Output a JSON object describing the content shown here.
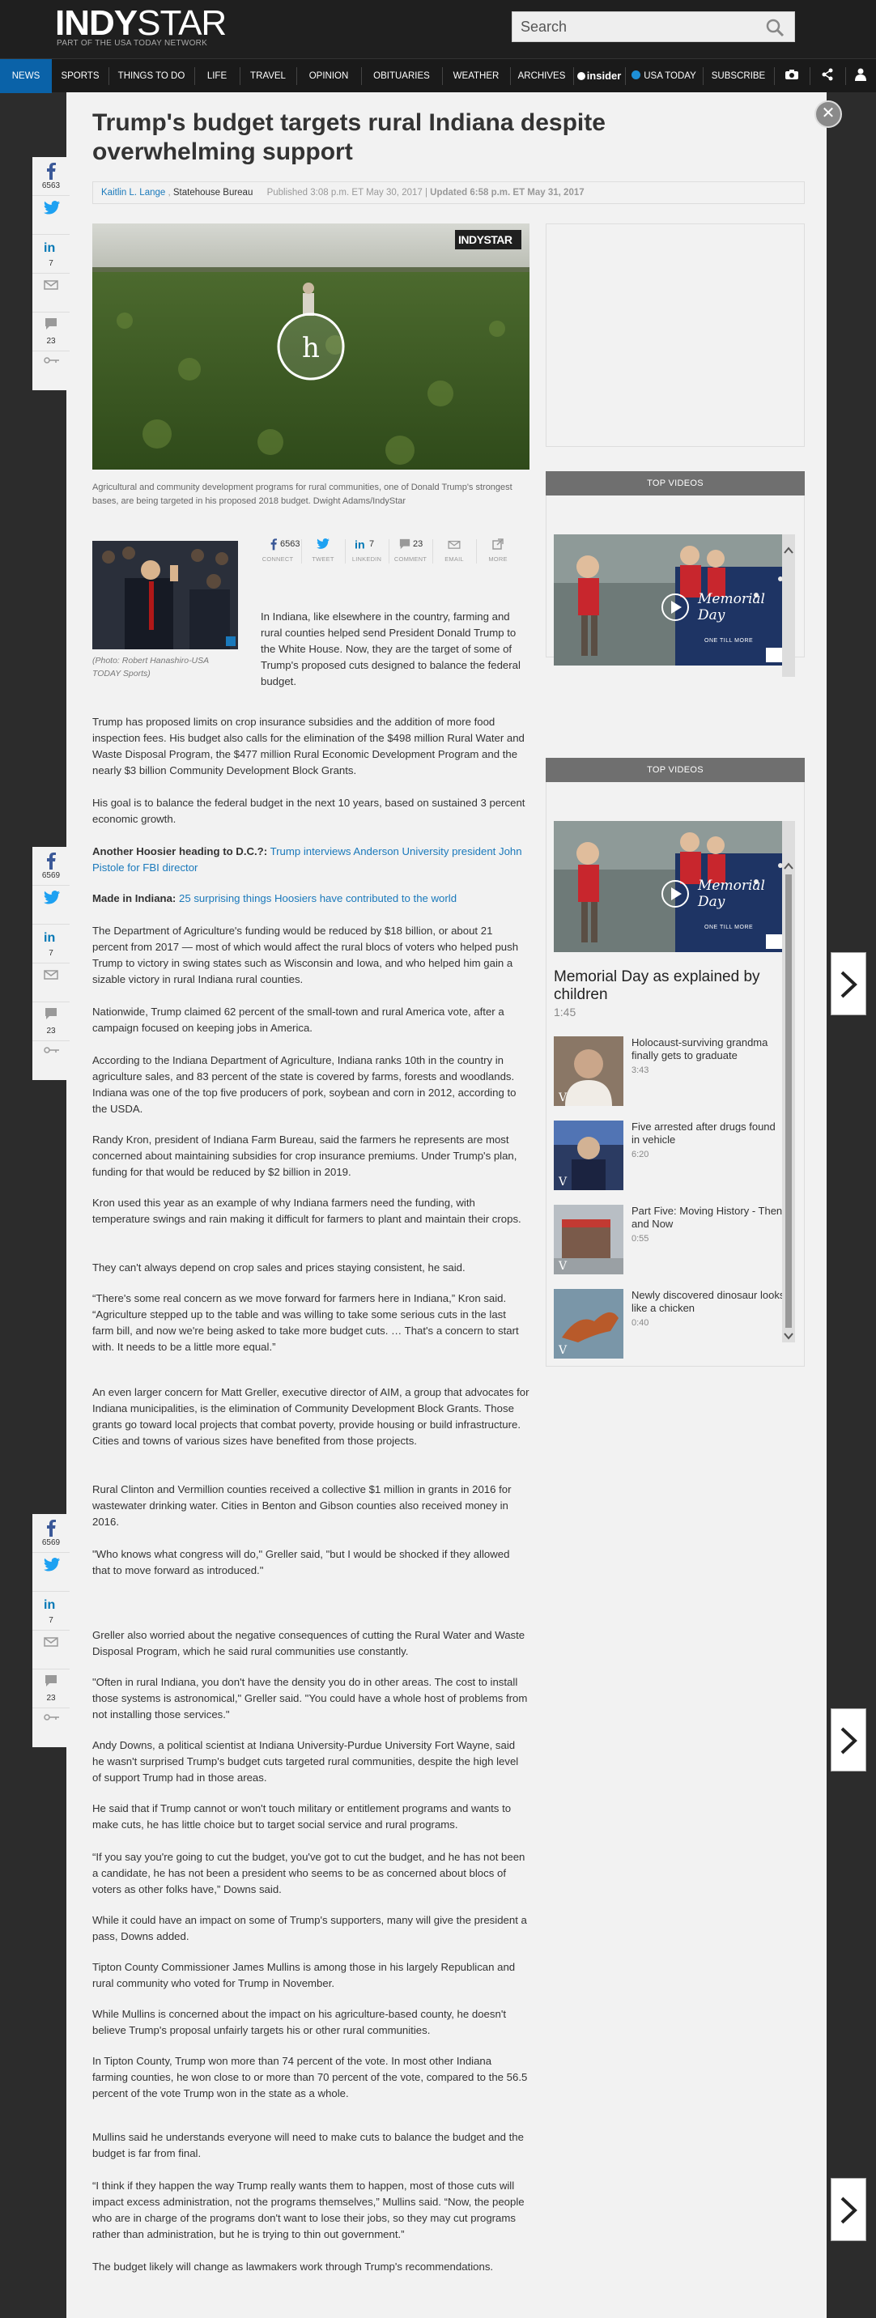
{
  "brand": {
    "name_bold": "INDY",
    "name_thin": "STAR",
    "tagline": "PART OF THE USA TODAY NETWORK"
  },
  "search": {
    "placeholder": "Search"
  },
  "nav": {
    "items": [
      "NEWS",
      "SPORTS",
      "THINGS TO DO",
      "LIFE",
      "TRAVEL",
      "OPINION",
      "OBITUARIES",
      "WEATHER",
      "ARCHIVES",
      "insider",
      "USA TODAY",
      "SUBSCRIBE"
    ],
    "active": "NEWS"
  },
  "article": {
    "title": "Trump's budget targets rural Indiana despite overwhelming support",
    "author": "Kaitlin L. Lange",
    "org": "Statehouse Bureau",
    "published": "Published 3:08 p.m. ET May 30, 2017",
    "updated": "Updated 6:58 p.m. ET May 31, 2017",
    "hero_caption": "Agricultural and community development programs for rural communities, one of Donald Trump's strongest bases, are being targeted in his proposed 2018 budget. Dwight Adams/IndyStar",
    "hero_watermark": "INDYSTAR",
    "small_caption": "(Photo: Robert Hanashiro-USA TODAY Sports)",
    "share": {
      "facebook": "6563",
      "linkedin": "7",
      "comments": "23",
      "labels": [
        "CONNECT",
        "TWEET",
        "LINKEDIN",
        "COMMENT",
        "EMAIL",
        "MORE"
      ]
    },
    "p1": "In Indiana, like elsewhere in the country, farming and rural counties helped send President Donald Trump to the White House. Now, they are the target of some of Trump's proposed cuts designed to balance the federal budget.",
    "p2": "Trump has proposed limits on crop insurance subsidies and the addition of more food inspection fees. His budget also calls for the elimination of the $498 million Rural Water and Waste Disposal Program, the $477 million Rural Economic Development Program and the nearly $3 billion Community Development Block Grants.",
    "p3": "His goal is to balance the federal budget in the next 10 years, based on sustained 3 percent economic growth.",
    "rel1_label": "Another Hoosier heading to D.C.?:",
    "rel1_link": "Trump interviews Anderson University president John Pistole for FBI director",
    "rel2_label": "Made in Indiana:",
    "rel2_link": "25 surprising things Hoosiers have contributed to the world",
    "p4": "The Department of Agriculture's funding would be reduced by $18 billion, or about 21 percent from 2017 — most of which would affect the rural blocs of voters who helped push Trump to victory in swing states such as Wisconsin and Iowa, and who helped him gain a sizable victory in rural Indiana rural counties.",
    "p5": "Nationwide, Trump claimed 62 percent of the small-town and rural America vote, after a campaign focused on keeping jobs in America.",
    "p6": "According to the Indiana Department of Agriculture, Indiana ranks 10th in the country in agriculture sales, and 83 percent of the state is covered by farms, forests and woodlands. Indiana was one of the top five producers of pork, soybean and corn in 2012, according to the USDA.",
    "p7": "Randy Kron, president of Indiana Farm Bureau, said the farmers he represents are most concerned about maintaining subsidies for crop insurance premiums. Under Trump's plan, funding for that would be reduced by $2 billion in 2019.",
    "p8": "Kron used this year as an example of why Indiana farmers need the funding, with temperature swings and rain making it difficult for farmers to plant and maintain their crops.",
    "p9": "They can't always depend on crop sales and prices staying consistent, he said.",
    "p10": "“There's some real concern as we move forward for farmers here in Indiana,” Kron said. “Agriculture stepped up to the table and was willing to take some serious cuts in the last farm bill, and now we're being asked to take more budget cuts. … That's a concern to start with. It needs to be a little more equal.”",
    "p11": "An even larger concern for Matt Greller, executive director of AIM, a group that advocates for Indiana municipalities, is the elimination of  Community Development Block Grants. Those grants go toward local projects that combat poverty, provide housing or build infrastructure. Cities and towns of various sizes have benefited from those projects.",
    "p12": "Rural Clinton and Vermillion counties received a collective $1 million in grants in 2016 for wastewater drinking water. Cities in Benton and Gibson counties also received money in 2016.",
    "p13": "\"Who knows what congress will do,\" Greller said, \"but I would be shocked if they allowed that to move forward as introduced.\"",
    "p14": "Greller also worried about the negative consequences of cutting the Rural Water and Waste Disposal Program, which he said rural communities use constantly.",
    "p15": "\"Often in rural Indiana, you don't have the density you do in other areas. The cost to install those systems is astronomical,\" Greller said. \"You could have a whole host of problems from not installing those services.\"",
    "p16": "Andy Downs, a political scientist at Indiana University-Purdue University Fort Wayne, said he wasn't surprised Trump's budget cuts targeted rural communities, despite the high level of support Trump had in those areas.",
    "p17": "He said that if Trump cannot or won't touch military or entitlement programs and wants to make cuts, he has little choice but to target social service and rural programs.",
    "p18": "“If you say you're going to cut the budget, you've got to cut the budget, and he has not been a candidate, he has not been a president who seems to be as concerned about blocs of voters as other folks have,” Downs said.",
    "p19": "While it could have an impact on some of Trump's supporters, many will give the president a pass, Downs added.",
    "p20": "Tipton County Commissioner James Mullins is among those in his largely Republican and rural community who voted for Trump in November.",
    "p21": "While Mullins is concerned about the impact on his agriculture-based county, he doesn't believe Trump's proposal unfairly targets his or other rural communities.",
    "p22": "In Tipton County, Trump won  more than 74 percent of the vote. In most other Indiana farming counties, he won close to or more than 70 percent of the vote, compared to the 56.5 percent of the vote Trump won in the state as a whole.",
    "p23": "Mullins said he understands everyone will need to make cuts to balance the budget and the budget is far from final.",
    "p24": "“I think if they happen the way Trump really wants them to happen, most of those cuts will impact excess administration, not the programs themselves,” Mullins said. “Now, the people who are in charge of the programs don't want to lose their jobs, so they may cut programs rather than administration, but he is trying to thin out government.”",
    "p25": "The budget likely will change as lawmakers work through Trump's recommendations."
  },
  "rail_counts": [
    {
      "fb": "6563",
      "in": "7",
      "cm": "23"
    },
    {
      "fb": "6569",
      "in": "7",
      "cm": "23"
    },
    {
      "fb": "6569",
      "in": "7",
      "cm": "23"
    }
  ],
  "videos": {
    "header": "TOP VIDEOS",
    "poster_text": "Memorial Day",
    "poster_sub": "ONE TILL MORE",
    "featured_title": "Memorial Day as explained by children",
    "featured_dur": "1:45",
    "list": [
      {
        "title": "Holocaust-surviving grandma finally gets to graduate",
        "dur": "3:43"
      },
      {
        "title": "Five arrested after drugs found in vehicle",
        "dur": "6:20"
      },
      {
        "title": "Part Five: Moving History - Then and Now",
        "dur": "0:55"
      },
      {
        "title": "Newly discovered dinosaur looks like a chicken",
        "dur": "0:40"
      }
    ]
  },
  "colors": {
    "nav_active": "#0a62a8",
    "link": "#1a79bb",
    "video_header": "#6f6f6f"
  }
}
